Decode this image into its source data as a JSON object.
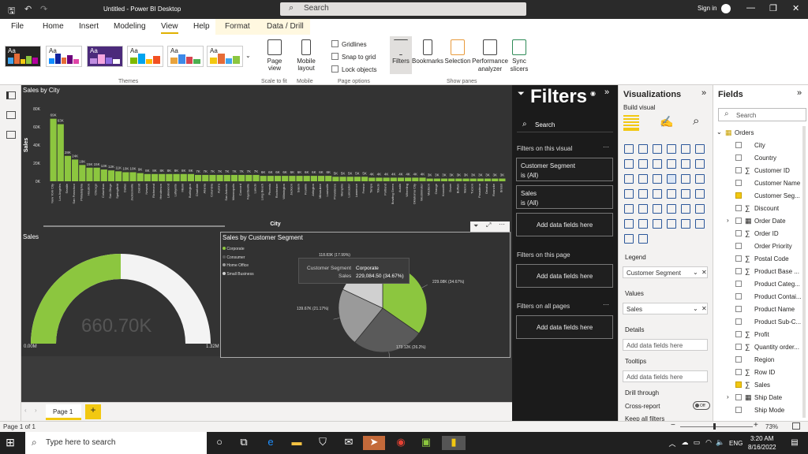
{
  "titlebar": {
    "title": "Untitled - Power BI Desktop",
    "search_placeholder": "Search",
    "signin": "Sign in"
  },
  "menu_tabs": [
    "File",
    "Home",
    "Insert",
    "Modeling",
    "View",
    "Help",
    "Format",
    "Data / Drill"
  ],
  "ribbon": {
    "themes_label": "Themes",
    "page_view": "Page view",
    "scale_to_fit": "Scale to fit",
    "mobile_layout": "Mobile layout",
    "mobile": "Mobile",
    "gridlines": "Gridlines",
    "snap_to_grid": "Snap to grid",
    "lock_objects": "Lock objects",
    "page_options": "Page options",
    "filters": "Filters",
    "bookmarks": "Bookmarks",
    "selection": "Selection",
    "performance_analyzer": "Performance analyzer",
    "sync_slicers": "Sync slicers",
    "show_panes": "Show panes",
    "theme_aa": "Aa"
  },
  "bar_chart": {
    "title": "Sales by City",
    "ylabel": "Sales",
    "xlabel": "City",
    "yticks": [
      "80K",
      "60K",
      "40K",
      "20K",
      "0K"
    ],
    "cities": [
      "New York City",
      "Los Angeles",
      "Seattle",
      "San Francisco",
      "Philadelphia",
      "Houston",
      "Chicago",
      "Columbus",
      "San Diego",
      "Springfield",
      "Dallas",
      "Jacksonville",
      "Detroit",
      "Newark",
      "Richmond",
      "Henderson",
      "Lakewood",
      "Lafayette",
      "Miami",
      "Burlington",
      "Charlotte",
      "Atlanta",
      "Columbia",
      "Aurora",
      "San Antonio",
      "Minneapolis",
      "Concord",
      "Fayetteville",
      "Laredo",
      "Long Beach",
      "Phoenix",
      "Rochester",
      "Wilmington",
      "Jackson",
      "Salem",
      "Franklin",
      "Arlington",
      "Milwaukee",
      "Louisville",
      "Providence",
      "Memphis",
      "Lancaster",
      "Lawrence",
      "Fresno",
      "Tampa",
      "Toledo",
      "Portland",
      "Bowling Green",
      "Austin",
      "Wheeling",
      "Oklahoma City",
      "Westminster",
      "Madison",
      "Orange",
      "Knoxville",
      "Dover",
      "Buffalo",
      "Marion",
      "Tucson",
      "Pasadena",
      "Omaha",
      "Roanoke",
      "Bristol"
    ],
    "value_labels": [
      "69K",
      "63K",
      "28K",
      "24K",
      "18K",
      "15K",
      "15K",
      "13K",
      "12K",
      "11K",
      "10K",
      "10K",
      "9K",
      "8K",
      "8K",
      "8K",
      "8K",
      "8K",
      "8K",
      "8K",
      "7K",
      "7K",
      "7K",
      "7K",
      "7K",
      "7K",
      "7K",
      "7K",
      "7K",
      "6K",
      "6K",
      "6K",
      "6K",
      "6K",
      "6K",
      "6K",
      "6K",
      "6K",
      "6K",
      "5K",
      "5K",
      "5K",
      "5K",
      "5K",
      "4K",
      "4K",
      "4K",
      "4K",
      "4K",
      "4K",
      "4K",
      "4K",
      "3K",
      "3K",
      "3K",
      "3K",
      "3K",
      "3K",
      "3K",
      "3K",
      "3K",
      "3K",
      "3K"
    ]
  },
  "chart_data": [
    {
      "type": "bar",
      "title": "Sales by City",
      "xlabel": "City",
      "ylabel": "Sales",
      "ylim": [
        0,
        80000
      ],
      "categories": [
        "New York City",
        "Los Angeles",
        "Seattle",
        "San Francisco",
        "Philadelphia",
        "Houston",
        "Chicago",
        "Columbus",
        "San Diego",
        "Springfield",
        "Dallas",
        "Jacksonville",
        "Detroit",
        "Newark",
        "Richmond",
        "Henderson",
        "Lakewood",
        "Lafayette",
        "Miami",
        "Burlington",
        "Charlotte",
        "Atlanta",
        "Columbia",
        "Aurora",
        "San Antonio",
        "Minneapolis",
        "Concord",
        "Fayetteville",
        "Laredo",
        "Long Beach",
        "Phoenix",
        "Rochester",
        "Wilmington",
        "Jackson",
        "Salem",
        "Franklin",
        "Arlington",
        "Milwaukee",
        "Louisville",
        "Providence",
        "Memphis",
        "Lancaster",
        "Lawrence",
        "Fresno",
        "Tampa",
        "Toledo",
        "Portland",
        "Bowling Green",
        "Austin",
        "Wheeling",
        "Oklahoma City",
        "Westminster",
        "Madison",
        "Orange",
        "Knoxville",
        "Dover",
        "Buffalo",
        "Marion",
        "Tucson",
        "Pasadena",
        "Omaha",
        "Roanoke",
        "Bristol"
      ],
      "values": [
        69000,
        63000,
        28000,
        24000,
        18000,
        15000,
        15000,
        13000,
        12000,
        11000,
        10000,
        10000,
        9000,
        8000,
        8000,
        8000,
        8000,
        8000,
        8000,
        8000,
        7000,
        7000,
        7000,
        7000,
        7000,
        7000,
        7000,
        7000,
        7000,
        6000,
        6000,
        6000,
        6000,
        6000,
        6000,
        6000,
        6000,
        6000,
        6000,
        5000,
        5000,
        5000,
        5000,
        5000,
        4000,
        4000,
        4000,
        4000,
        4000,
        4000,
        4000,
        4000,
        3000,
        3000,
        3000,
        3000,
        3000,
        3000,
        3000,
        3000,
        3000,
        3000,
        3000
      ]
    },
    {
      "type": "pie",
      "title": "Sales by Customer Segment",
      "categories": [
        "Corporate",
        "Consumer",
        "Home Office",
        "Small Business"
      ],
      "values": [
        229.08,
        173.12,
        139.67,
        118.83
      ],
      "labels": [
        "229.08K (34.67%)",
        "173.12K (26.2%)",
        "139.67K (21.17%)",
        "118.83K (17.99%)"
      ],
      "colors": [
        "#8cc63f",
        "#5a5a5a",
        "#9a9a9a",
        "#d0d0d0"
      ]
    }
  ],
  "gauge": {
    "title": "Sales",
    "value": "660.70K",
    "min": "0.00M",
    "max": "1.32M",
    "fill_fraction": 0.5
  },
  "pie": {
    "title": "Sales by Customer Segment",
    "legend": [
      "Corporate",
      "Consumer",
      "Home Office",
      "Small Business"
    ],
    "tooltip": {
      "k1": "Customer Segment",
      "v1": "Corporate",
      "k2": "Sales",
      "v2": "229,084.50 (34.67%)"
    }
  },
  "filters_pane": {
    "title": "Filters",
    "search": "Search",
    "on_visual": "Filters on this visual",
    "card1_name": "Customer Segment",
    "card1_val": "is (All)",
    "card2_name": "Sales",
    "card2_val": "is (All)",
    "add": "Add data fields here",
    "on_page": "Filters on this page",
    "on_all": "Filters on all pages"
  },
  "viz_pane": {
    "title": "Visualizations",
    "build": "Build visual",
    "legend": "Legend",
    "legend_val": "Customer Segment",
    "values": "Values",
    "values_val": "Sales",
    "details": "Details",
    "details_add": "Add data fields here",
    "tooltips": "Tooltips",
    "tooltips_add": "Add data fields here",
    "drill": "Drill through",
    "cross": "Cross-report",
    "cross_toggle": "Off",
    "keep": "Keep all filters"
  },
  "fields_pane": {
    "title": "Fields",
    "search": "Search",
    "table": "Orders",
    "items": [
      {
        "name": "City",
        "sigma": "",
        "checked": false,
        "expand": ""
      },
      {
        "name": "Country",
        "sigma": "",
        "checked": false,
        "expand": ""
      },
      {
        "name": "Customer ID",
        "sigma": "∑",
        "checked": false,
        "expand": ""
      },
      {
        "name": "Customer Name",
        "sigma": "",
        "checked": false,
        "expand": ""
      },
      {
        "name": "Customer Seg...",
        "sigma": "",
        "checked": true,
        "expand": ""
      },
      {
        "name": "Discount",
        "sigma": "∑",
        "checked": false,
        "expand": ""
      },
      {
        "name": "Order Date",
        "sigma": "▦",
        "checked": false,
        "expand": "›"
      },
      {
        "name": "Order ID",
        "sigma": "∑",
        "checked": false,
        "expand": ""
      },
      {
        "name": "Order Priority",
        "sigma": "",
        "checked": false,
        "expand": ""
      },
      {
        "name": "Postal Code",
        "sigma": "∑",
        "checked": false,
        "expand": ""
      },
      {
        "name": "Product Base ...",
        "sigma": "∑",
        "checked": false,
        "expand": ""
      },
      {
        "name": "Product Categ...",
        "sigma": "",
        "checked": false,
        "expand": ""
      },
      {
        "name": "Product Contai...",
        "sigma": "",
        "checked": false,
        "expand": ""
      },
      {
        "name": "Product Name",
        "sigma": "",
        "checked": false,
        "expand": ""
      },
      {
        "name": "Product Sub-C...",
        "sigma": "",
        "checked": false,
        "expand": ""
      },
      {
        "name": "Profit",
        "sigma": "∑",
        "checked": false,
        "expand": ""
      },
      {
        "name": "Quantity order...",
        "sigma": "∑",
        "checked": false,
        "expand": ""
      },
      {
        "name": "Region",
        "sigma": "",
        "checked": false,
        "expand": ""
      },
      {
        "name": "Row ID",
        "sigma": "∑",
        "checked": false,
        "expand": ""
      },
      {
        "name": "Sales",
        "sigma": "∑",
        "checked": true,
        "expand": ""
      },
      {
        "name": "Ship Date",
        "sigma": "▦",
        "checked": false,
        "expand": "›"
      },
      {
        "name": "Ship Mode",
        "sigma": "",
        "checked": false,
        "expand": ""
      }
    ]
  },
  "page_tab": "Page 1",
  "status": {
    "page": "Page 1 of 1",
    "zoom": "73%"
  },
  "taskbar": {
    "search": "Type here to search",
    "time": "3:20 AM",
    "date": "8/16/2022",
    "lang": "ENG"
  },
  "colors": {
    "accent_green": "#8cc63f",
    "brand_yellow": "#f2c811"
  }
}
